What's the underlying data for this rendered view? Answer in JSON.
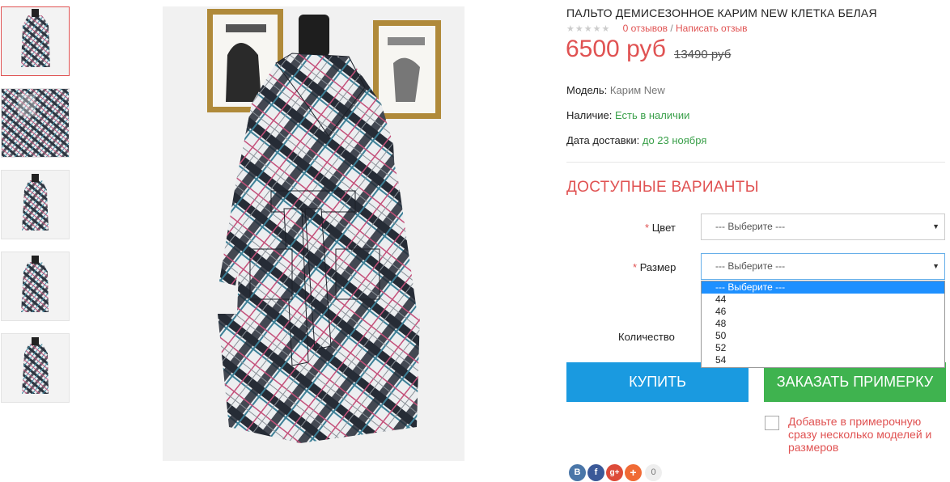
{
  "product": {
    "title": "ПАЛЬТО ДЕМИСЕЗОННОЕ КАРИМ NEW КЛЕТКА БЕЛАЯ",
    "rating_stars": "★★★★★",
    "reviews_count": "0 отзывов",
    "separator": " / ",
    "write_review": "Написать отзыв",
    "price": "6500 руб",
    "old_price": "13490 руб"
  },
  "details": {
    "model_label": "Модель:",
    "model_value": "Карим New",
    "availability_label": "Наличие:",
    "availability_value": "Есть в наличии",
    "delivery_label": "Дата доставки:",
    "delivery_value": "до 23 ноября"
  },
  "options": {
    "heading": "ДОСТУПНЫЕ ВАРИАНТЫ",
    "required_mark": "*",
    "color_label": "Цвет",
    "color_value": "--- Выберите ---",
    "size_label": "Размер",
    "size_value": "--- Выберите ---",
    "size_options": [
      "--- Выберите ---",
      "44",
      "46",
      "48",
      "50",
      "52",
      "54"
    ],
    "quantity_label": "Количество"
  },
  "actions": {
    "buy_label": "КУПИТЬ",
    "fitting_label": "ЗАКАЗАТЬ ПРИМЕРКУ",
    "fitting_note": "Добавьте в примерочную сразу несколько моделей и размеров"
  },
  "social": {
    "vk": "В",
    "facebook": "f",
    "googleplus": "g+",
    "more": "+",
    "count": "0"
  },
  "colors": {
    "accent": "#e05252",
    "buy": "#1a9ae0",
    "fitting": "#3fb34f",
    "in_stock": "#3aa04a"
  },
  "gallery": {
    "thumbnail_count": 5,
    "active_index": 0
  }
}
